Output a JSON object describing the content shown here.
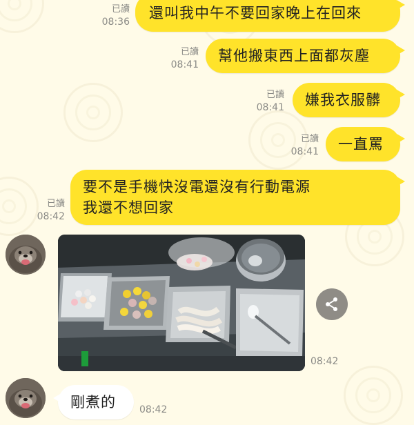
{
  "messages": [
    {
      "direction": "outgoing",
      "text": "還叫我中午不要回家晚上在回來",
      "read_label": "已讀",
      "time": "08:36"
    },
    {
      "direction": "outgoing",
      "text": "幫他搬東西上面都灰塵",
      "read_label": "已讀",
      "time": "08:41"
    },
    {
      "direction": "outgoing",
      "text": "嫌我衣服髒",
      "read_label": "已讀",
      "time": "08:41"
    },
    {
      "direction": "outgoing",
      "text": "一直罵",
      "read_label": "已讀",
      "time": "08:41"
    },
    {
      "direction": "outgoing",
      "text": "要不是手機快沒電還沒有行動電源\n我還不想回家",
      "read_label": "已讀",
      "time": "08:42"
    },
    {
      "direction": "incoming",
      "type": "image",
      "time": "08:42"
    },
    {
      "direction": "incoming",
      "text": "剛煮的",
      "time": "08:42"
    }
  ],
  "icons": {
    "share": "share-icon",
    "avatar": "otter-avatar"
  },
  "colors": {
    "background": "#fffbe8",
    "outgoing_bubble": "#ffe32a",
    "incoming_bubble": "#ffffff",
    "meta_text": "#8a8a86",
    "share_button": "#8f8c86"
  }
}
